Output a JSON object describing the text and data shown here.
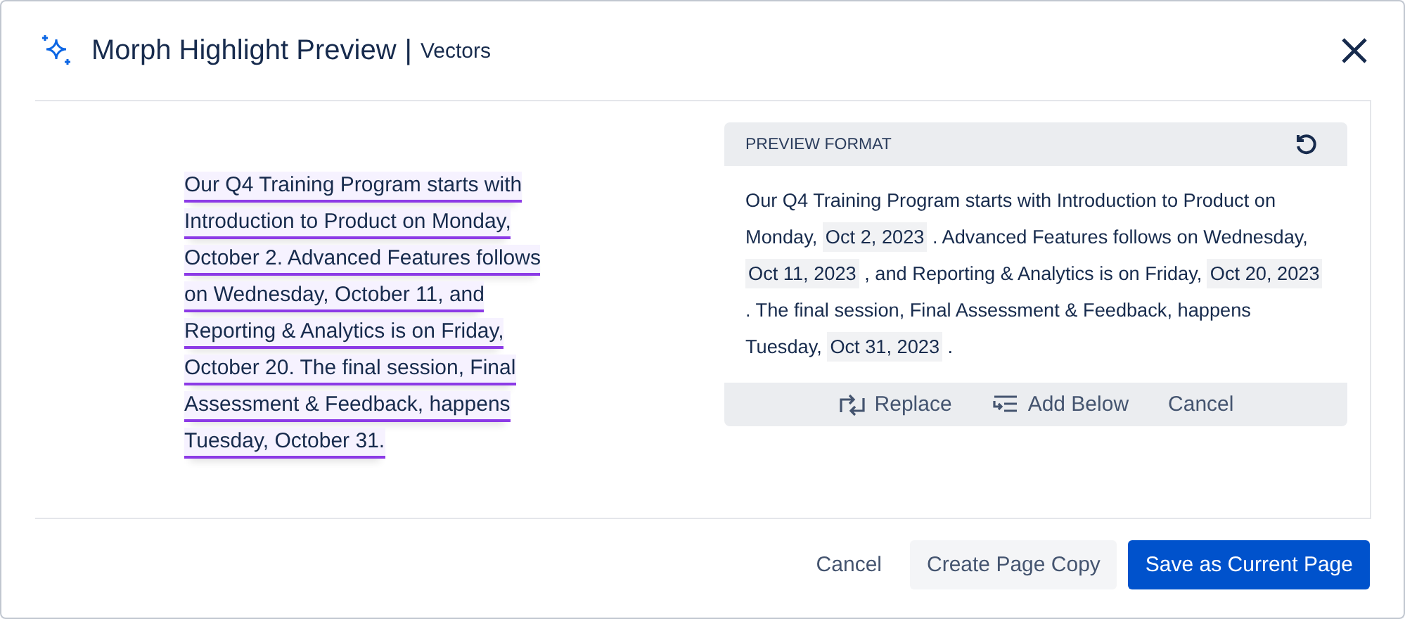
{
  "dialog": {
    "title": "Morph Highlight Preview",
    "separator": "|",
    "subtitle": "Vectors"
  },
  "source_lines": [
    "Our Q4 Training Program starts with",
    "Introduction to Product on Monday,",
    "October 2. Advanced Features follows",
    "on Wednesday, October 11, and",
    "Reporting & Analytics is on Friday,",
    "October 20. The final session, Final",
    "Assessment & Feedback, happens",
    "Tuesday, October 31."
  ],
  "preview": {
    "heading": "PREVIEW FORMAT",
    "segments": [
      {
        "kind": "text",
        "text": "Our Q4 Training Program starts with Introduction to Product on Monday, "
      },
      {
        "kind": "date",
        "text": "Oct 2, 2023"
      },
      {
        "kind": "text",
        "text": " . Advanced Features follows on Wednesday, "
      },
      {
        "kind": "date",
        "text": "Oct 11, 2023"
      },
      {
        "kind": "text",
        "text": " , and Reporting & Analytics is on Friday, "
      },
      {
        "kind": "date",
        "text": "Oct 20, 2023"
      },
      {
        "kind": "text",
        "text": " . The final session, Final Assessment & Feedback, happens Tuesday, "
      },
      {
        "kind": "date",
        "text": "Oct 31, 2023"
      },
      {
        "kind": "text",
        "text": " ."
      }
    ],
    "actions": [
      {
        "kind": "replace",
        "label": "Replace"
      },
      {
        "kind": "add-below",
        "label": "Add Below"
      },
      {
        "kind": "cancel",
        "label": "Cancel"
      }
    ]
  },
  "footer": [
    {
      "kind": "link",
      "label": "Cancel"
    },
    {
      "kind": "secondary",
      "label": "Create Page Copy"
    },
    {
      "kind": "primary",
      "label": "Save as Current Page"
    }
  ]
}
